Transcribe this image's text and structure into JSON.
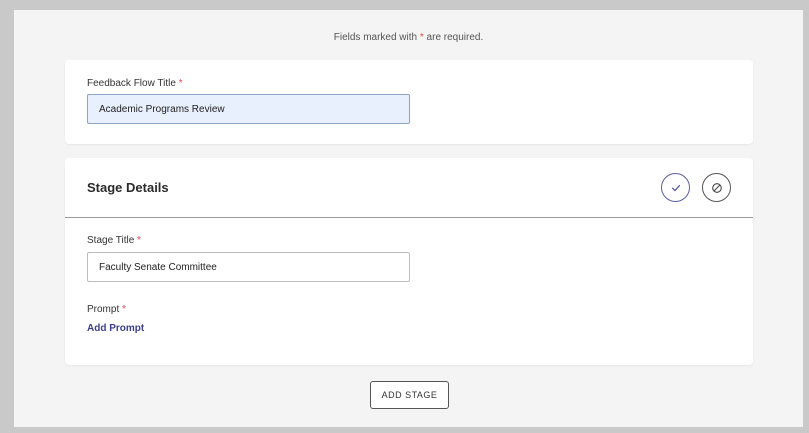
{
  "required_note": {
    "prefix": "Fields marked with ",
    "marker": "*",
    "suffix": " are required."
  },
  "title_card": {
    "label": "Feedback Flow Title ",
    "required_marker": "*",
    "input_value": "Academic Programs Review"
  },
  "stage_card": {
    "heading": "Stage Details",
    "confirm_icon": "check-icon",
    "cancel_icon": "prohibit-icon",
    "stage_title_label": "Stage Title ",
    "stage_title_marker": "*",
    "stage_title_value": "Faculty Senate Committee",
    "prompt_label": "Prompt ",
    "prompt_marker": "*",
    "add_prompt_label": "Add Prompt"
  },
  "add_stage_button": "ADD STAGE",
  "colors": {
    "required": "#e5484d",
    "link": "#3b3f8c",
    "highlight_input": "#e8f0fe"
  }
}
